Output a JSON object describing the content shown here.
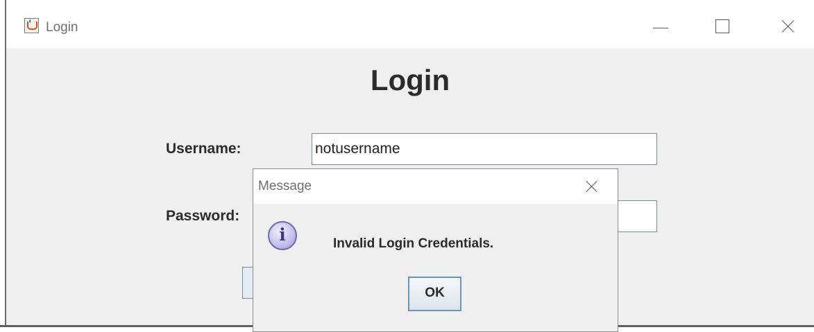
{
  "window": {
    "title": "Login",
    "icon": "java-coffee-cup-icon",
    "controls": [
      "minimize-icon",
      "maximize-icon",
      "close-icon"
    ]
  },
  "form": {
    "heading": "Login",
    "username_label": "Username:",
    "username_value": "notusername",
    "password_label": "Password:",
    "password_value": ""
  },
  "dialog": {
    "title": "Message",
    "icon": "info-icon",
    "icon_glyph": "i",
    "message": "Invalid Login Credentials.",
    "ok_label": "OK"
  },
  "colors": {
    "window_background": "#efefef",
    "titlebar_background": "#ffffff",
    "ok_button_border": "#6f92b7",
    "info_icon_fill": "#c7c2ee"
  }
}
